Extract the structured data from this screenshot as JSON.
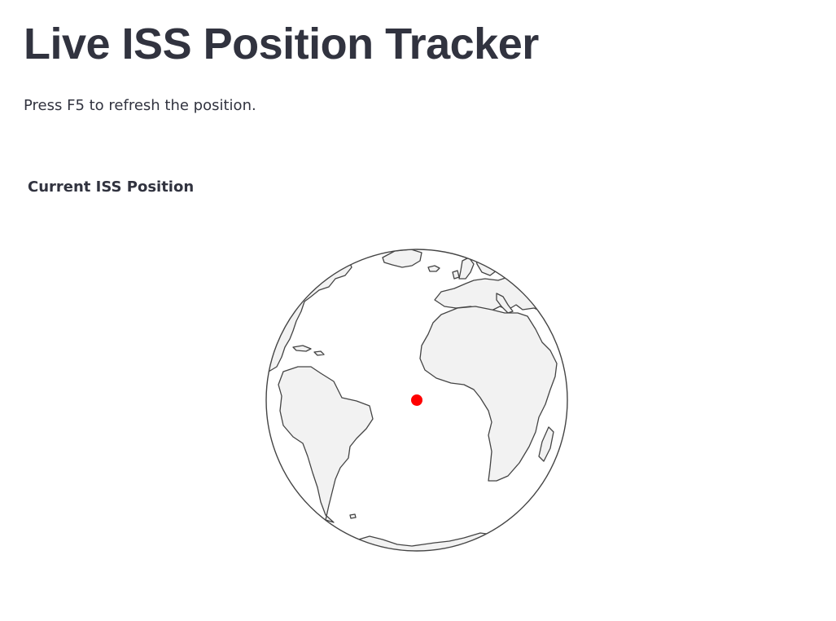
{
  "page": {
    "title": "Live ISS Position Tracker",
    "caption": "Press F5 to refresh the position."
  },
  "map": {
    "title": "Current ISS Position",
    "projection": "orthographic",
    "ocean_color": "#ffffff",
    "land_color": "#f2f2f2",
    "coastline_color": "#444444",
    "marker_color": "#ff0000",
    "marker_icon": "iss-marker-dot"
  }
}
